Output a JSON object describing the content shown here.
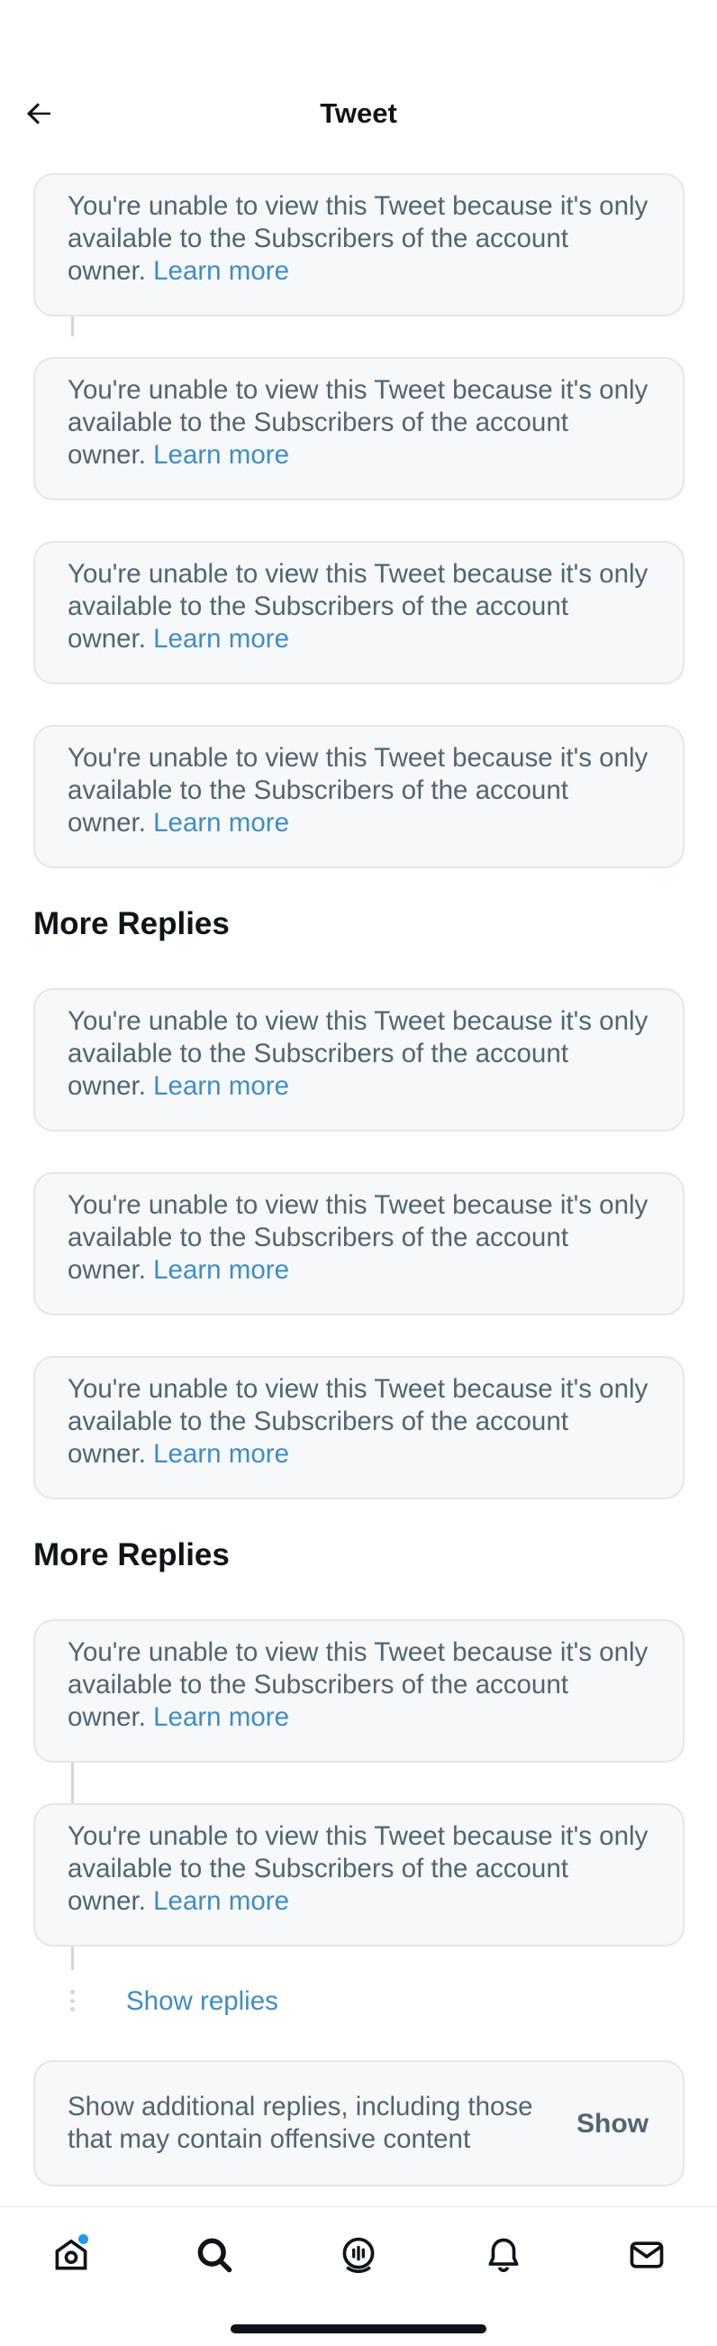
{
  "header": {
    "title": "Tweet"
  },
  "restricted_message": {
    "text": "You're unable to view this Tweet because it's only available to the Subscribers of the account owner.",
    "link": "Learn more"
  },
  "sections": {
    "more_replies_1": "More Replies",
    "more_replies_2": "More Replies"
  },
  "show_replies": "Show replies",
  "additional_replies": {
    "text": "Show additional replies, including those that may contain offensive content",
    "button": "Show"
  },
  "tabbar": {
    "items": [
      "home-icon",
      "search-icon",
      "spaces-icon",
      "notifications-icon",
      "messages-icon"
    ],
    "home_has_unread_dot": true
  },
  "colors": {
    "link": "#3f8dc7",
    "card_bg": "#f6f8f9",
    "card_border": "#e3e7ea",
    "muted_text": "#536471",
    "notification_dot": "#1d9bf0"
  }
}
